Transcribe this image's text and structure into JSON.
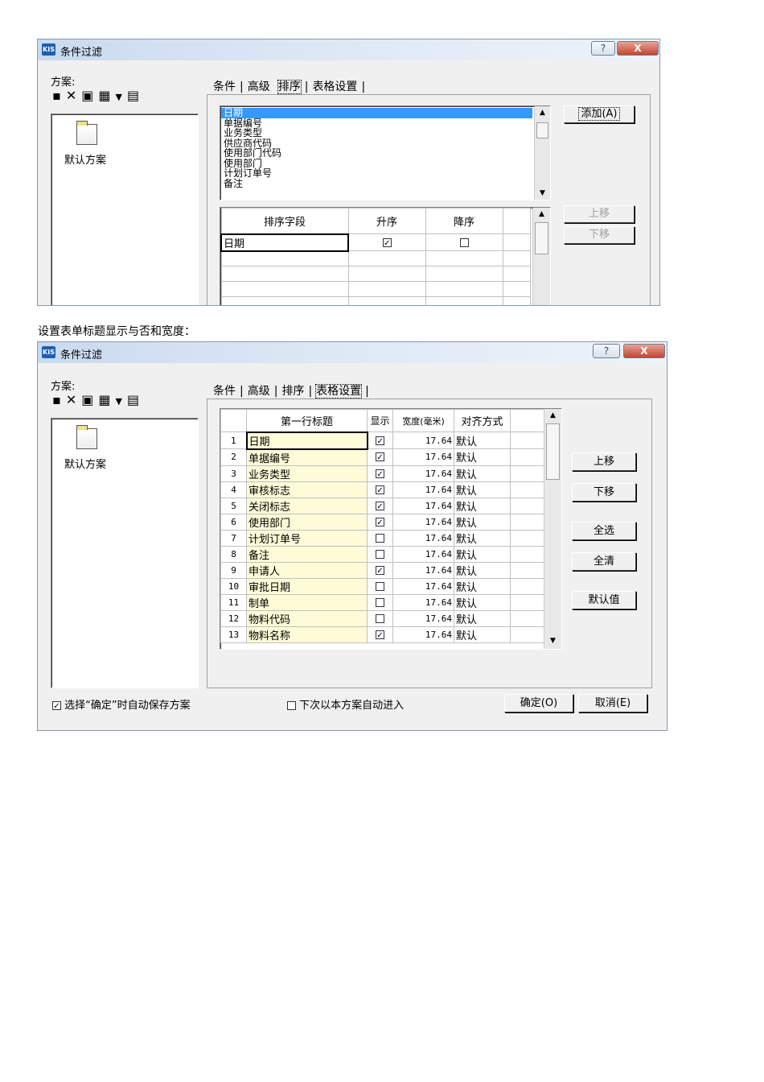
{
  "dialog1": {
    "title": "条件过滤",
    "help_label": "?",
    "close_label": "X",
    "scheme_label": "方案:",
    "default_scheme": "默认方案",
    "tabs": [
      "条件",
      "高级",
      "排序",
      "表格设置"
    ],
    "active_tab": "排序",
    "field_list": [
      "日期",
      "单据编号",
      "业务类型",
      "供应商代码",
      "使用部门代码",
      "使用部门",
      "计划订单号",
      "备注"
    ],
    "selected_field": "日期",
    "add_button": "添加(A)",
    "move_up": "上移",
    "move_down": "下移",
    "sort_headers": [
      "排序字段",
      "升序",
      "降序"
    ],
    "sort_rows": [
      {
        "field": "日期",
        "asc": true,
        "desc": false
      }
    ]
  },
  "caption": "设置表单标题显示与否和宽度：",
  "dialog2": {
    "title": "条件过滤",
    "help_label": "?",
    "close_label": "X",
    "scheme_label": "方案:",
    "default_scheme": "默认方案",
    "tabs": [
      "条件",
      "高级",
      "排序",
      "表格设置"
    ],
    "active_tab": "表格设置",
    "grid_headers": [
      "",
      "第一行标题",
      "显示",
      "宽度(毫米)",
      "对齐方式"
    ],
    "grid_rows": [
      {
        "n": "1",
        "title": "日期",
        "show": true,
        "width": "17.64",
        "align": "默认"
      },
      {
        "n": "2",
        "title": "单据编号",
        "show": true,
        "width": "17.64",
        "align": "默认"
      },
      {
        "n": "3",
        "title": "业务类型",
        "show": true,
        "width": "17.64",
        "align": "默认"
      },
      {
        "n": "4",
        "title": "审核标志",
        "show": true,
        "width": "17.64",
        "align": "默认"
      },
      {
        "n": "5",
        "title": "关闭标志",
        "show": true,
        "width": "17.64",
        "align": "默认"
      },
      {
        "n": "6",
        "title": "使用部门",
        "show": true,
        "width": "17.64",
        "align": "默认"
      },
      {
        "n": "7",
        "title": "计划订单号",
        "show": false,
        "width": "17.64",
        "align": "默认"
      },
      {
        "n": "8",
        "title": "备注",
        "show": false,
        "width": "17.64",
        "align": "默认"
      },
      {
        "n": "9",
        "title": "申请人",
        "show": true,
        "width": "17.64",
        "align": "默认"
      },
      {
        "n": "10",
        "title": "审批日期",
        "show": false,
        "width": "17.64",
        "align": "默认"
      },
      {
        "n": "11",
        "title": "制单",
        "show": false,
        "width": "17.64",
        "align": "默认"
      },
      {
        "n": "12",
        "title": "物料代码",
        "show": false,
        "width": "17.64",
        "align": "默认"
      },
      {
        "n": "13",
        "title": "物料名称",
        "show": true,
        "width": "17.64",
        "align": "默认"
      }
    ],
    "buttons": [
      "上移",
      "下移",
      "全选",
      "全清",
      "默认值"
    ],
    "auto_save_label": "选择“确定”时自动保存方案",
    "auto_save_checked": true,
    "auto_enter_label": "下次以本方案自动进入",
    "auto_enter_checked": false,
    "ok_label": "确定(O)",
    "cancel_label": "取消(E)"
  }
}
